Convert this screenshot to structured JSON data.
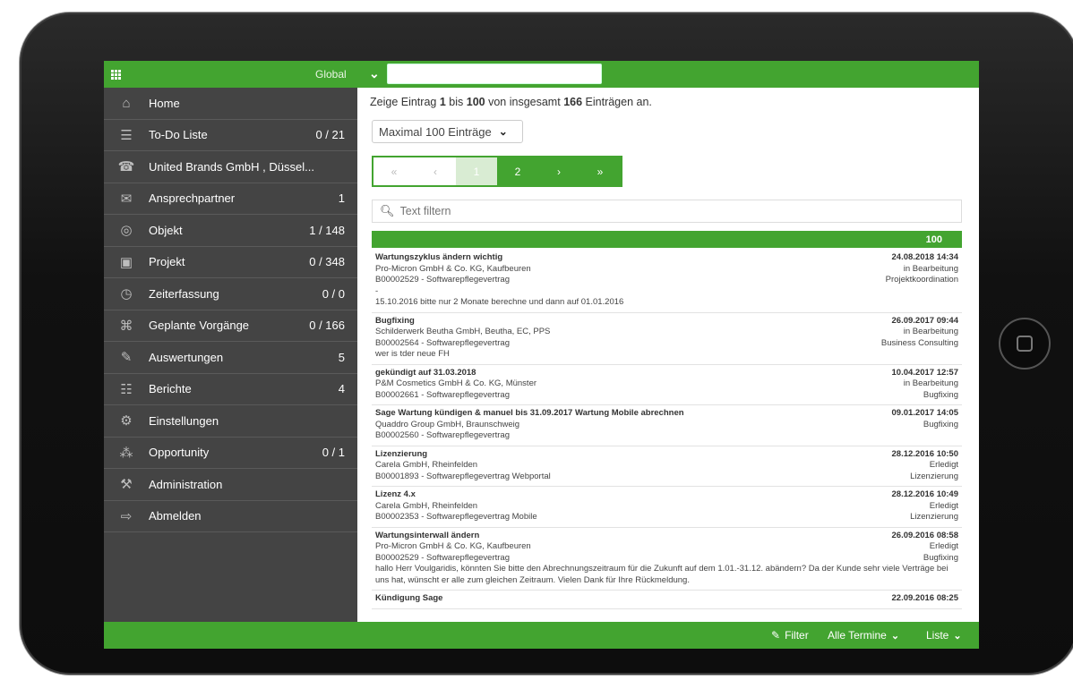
{
  "topbar": {
    "scope_label": "Global",
    "search_value": ""
  },
  "sidebar": {
    "items": [
      {
        "label": "Home",
        "count": "",
        "icon": "home-icon"
      },
      {
        "label": "To-Do Liste",
        "count": "0 / 21",
        "icon": "todo-icon"
      },
      {
        "label": "United Brands GmbH , Düssel...",
        "count": "",
        "icon": "contact-card-icon"
      },
      {
        "label": "Ansprechpartner",
        "count": "1",
        "icon": "chat-icon"
      },
      {
        "label": "Objekt",
        "count": "1 / 148",
        "icon": "target-icon"
      },
      {
        "label": "Projekt",
        "count": "0 / 348",
        "icon": "project-icon"
      },
      {
        "label": "Zeiterfassung",
        "count": "0 / 0",
        "icon": "clock-icon"
      },
      {
        "label": "Geplante Vorgänge",
        "count": "0 / 166",
        "icon": "share-icon"
      },
      {
        "label": "Auswertungen",
        "count": "5",
        "icon": "pen-icon"
      },
      {
        "label": "Berichte",
        "count": "4",
        "icon": "report-icon"
      },
      {
        "label": "Einstellungen",
        "count": "",
        "icon": "gears-icon"
      },
      {
        "label": "Opportunity",
        "count": "0 / 1",
        "icon": "network-icon"
      },
      {
        "label": "Administration",
        "count": "",
        "icon": "wrench-icon"
      },
      {
        "label": "Abmelden",
        "count": "",
        "icon": "logout-icon"
      }
    ]
  },
  "main": {
    "info": {
      "prefix": "Zeige Eintrag",
      "from": "1",
      "mid1": "bis",
      "to": "100",
      "mid2": "von insgesamt",
      "total": "166",
      "suffix": "Einträgen an."
    },
    "max_select": "Maximal 100 Einträge",
    "pager": {
      "first": "«",
      "prev": "‹",
      "page1": "1",
      "page2": "2",
      "next": "›",
      "last": "»"
    },
    "filter_placeholder": "Text filtern",
    "list_count": "100",
    "entries": [
      {
        "title": "Wartungszyklus ändern wichtig",
        "date": "24.08.2018 14:34",
        "company": "Pro-Micron GmbH & Co. KG, Kaufbeuren",
        "status": "in Bearbeitung",
        "contract": "B00002529 - Softwarepflegevertrag",
        "category": "Projektkoordination",
        "notes": [
          "-",
          "15.10.2016 bitte nur 2 Monate berechne und dann auf 01.01.2016"
        ]
      },
      {
        "title": "Bugfixing",
        "date": "26.09.2017 09:44",
        "company": "Schilderwerk Beutha GmbH, Beutha, EC, PPS",
        "status": "in Bearbeitung",
        "contract": "B00002564 - Softwarepflegevertrag",
        "category": "Business Consulting",
        "notes": [
          "wer is tder neue FH"
        ]
      },
      {
        "title": "gekündigt auf 31.03.2018",
        "date": "10.04.2017 12:57",
        "company": "P&M Cosmetics GmbH & Co. KG, Münster",
        "status": "in Bearbeitung",
        "contract": "B00002661 - Softwarepflegevertrag",
        "category": "Bugfixing",
        "notes": []
      },
      {
        "title": "Sage Wartung kündigen & manuel bis 31.09.2017 Wartung Mobile abrechnen",
        "date": "09.01.2017 14:05",
        "company": "Quaddro Group GmbH, Braunschweig",
        "status": "Bugfixing",
        "contract": "B00002560 - Softwarepflegevertrag",
        "category": "",
        "notes": []
      },
      {
        "title": "Lizenzierung",
        "date": "28.12.2016 10:50",
        "company": "Carela GmbH, Rheinfelden",
        "status": "Erledigt",
        "contract": "B00001893 - Softwarepflegevertrag Webportal",
        "category": "Lizenzierung",
        "notes": []
      },
      {
        "title": "Lizenz 4.x",
        "date": "28.12.2016 10:49",
        "company": "Carela GmbH, Rheinfelden",
        "status": "Erledigt",
        "contract": "B00002353 - Softwarepflegevertrag Mobile",
        "category": "Lizenzierung",
        "notes": []
      },
      {
        "title": "Wartungsinterwall ändern",
        "date": "26.09.2016 08:58",
        "company": "Pro-Micron GmbH & Co. KG, Kaufbeuren",
        "status": "Erledigt",
        "contract": "B00002529 - Softwarepflegevertrag",
        "category": "Bugfixing",
        "notes": [
          "hallo Herr Voulgaridis, könnten Sie bitte den Abrechnungszeitraum für die Zukunft auf dem 1.01.-31.12. abändern? Da der Kunde sehr viele Verträge bei uns hat, wünscht er alle zum gleichen Zeitraum. Vielen Dank für Ihre Rückmeldung."
        ]
      },
      {
        "title": "Kündigung Sage",
        "date": "22.09.2016 08:25",
        "company": "",
        "status": "",
        "contract": "",
        "category": "",
        "notes": []
      }
    ]
  },
  "bottombar": {
    "filter_label": "Filter",
    "appointments_label": "Alle Termine",
    "view_label": "Liste"
  },
  "colors": {
    "accent_green": "#43a430",
    "sidebar_bg": "#444444"
  }
}
